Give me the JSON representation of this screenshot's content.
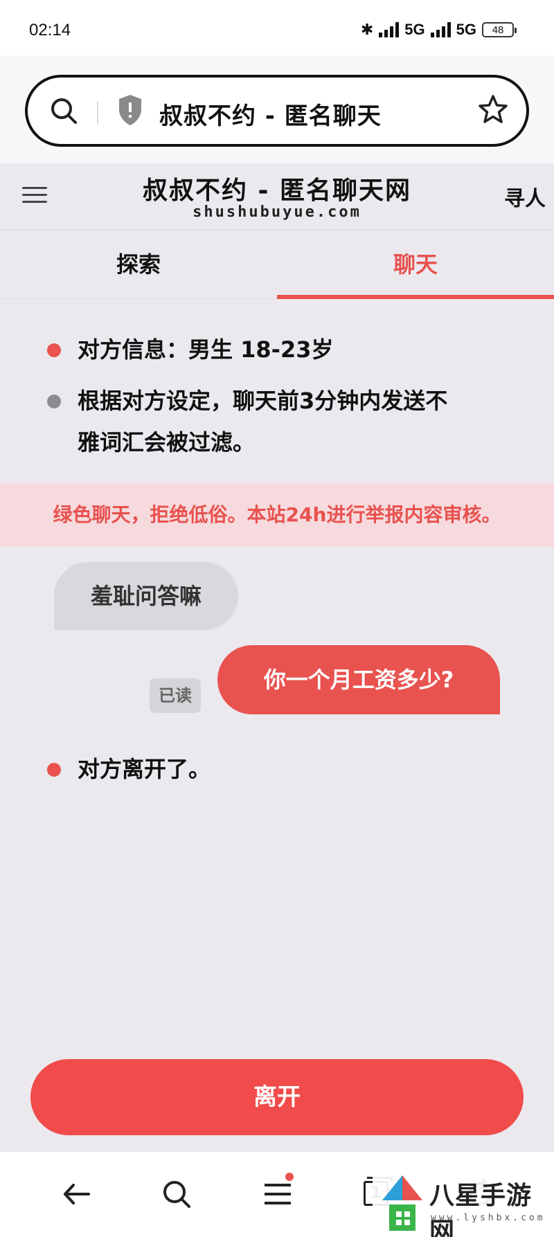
{
  "status_bar": {
    "time": "02:14",
    "network_1": "5G",
    "network_2": "5G",
    "battery": "48"
  },
  "browser": {
    "url_title": "叔叔不约 - 匿名聊天"
  },
  "site": {
    "title": "叔叔不约 - 匿名聊天网",
    "domain": "shushubuyue.com",
    "find_label": "寻人"
  },
  "tabs": [
    {
      "label": "探索",
      "active": false
    },
    {
      "label": "聊天",
      "active": true
    }
  ],
  "chat": {
    "partner_info": "对方信息：男生 18-23岁",
    "filter_notice_line1": "根据对方设定，聊天前3分钟内发送不",
    "filter_notice_line2": "雅词汇会被过滤。",
    "warning_banner": "绿色聊天，拒绝低俗。本站24h进行举报内容审核。",
    "messages": [
      {
        "side": "left",
        "text": "羞耻问答嘛"
      },
      {
        "side": "right",
        "text": "你一个月工资多少?",
        "status": "已读"
      }
    ],
    "partner_left": "对方离开了。"
  },
  "leave_button": {
    "label": "离开"
  },
  "bottom_nav": {
    "tab_count": "1"
  },
  "watermark": {
    "text": "八星手游网",
    "url": "www.lyshbx.com"
  },
  "colors": {
    "accent": "#e8524f",
    "leave_button": "#f14b4b",
    "chat_background": "#ebe9ee",
    "warning_background": "#f6dadd",
    "received_bubble": "#d9d8dd"
  }
}
